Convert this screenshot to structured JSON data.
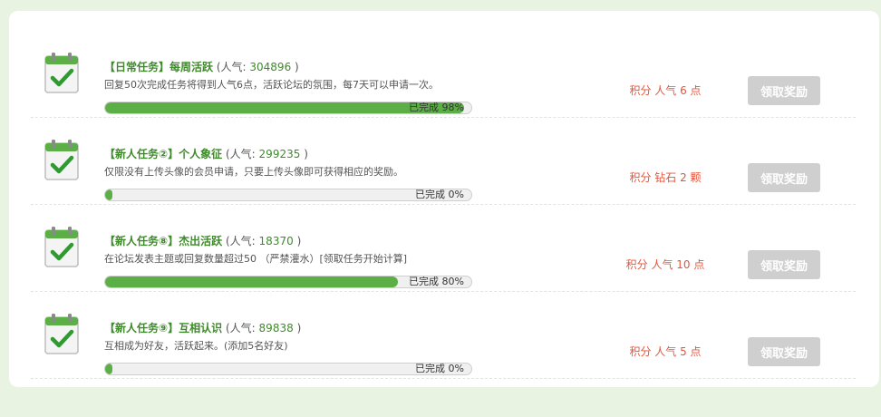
{
  "tasks": [
    {
      "title": "【日常任务】每周活跃",
      "popularity_label": "(人气: ",
      "popularity_value": "304896",
      "popularity_close": ")",
      "description": "回复50次完成任务将得到人气6点，活跃论坛的氛围，每7天可以申请一次。",
      "progress_percent": 98,
      "progress_label": "已完成 98%",
      "reward": "积分 人气 6 点",
      "claim_label": "领取奖励"
    },
    {
      "title": "【新人任务②】个人象征",
      "popularity_label": "(人气: ",
      "popularity_value": "299235",
      "popularity_close": ")",
      "description": "仅限没有上传头像的会员申请，只要上传头像即可获得相应的奖励。",
      "progress_percent": 0,
      "progress_label": "已完成 0%",
      "reward": "积分 钻石 2 颗",
      "claim_label": "领取奖励"
    },
    {
      "title": "【新人任务⑧】杰出活跃",
      "popularity_label": "(人气: ",
      "popularity_value": "18370",
      "popularity_close": ")",
      "description": "在论坛发表主题或回复数量超过50 （严禁灌水）[领取任务开始计算]",
      "progress_percent": 80,
      "progress_label": "已完成 80%",
      "reward": "积分 人气 10 点",
      "claim_label": "领取奖励"
    },
    {
      "title": "【新人任务⑨】互相认识",
      "popularity_label": "(人气: ",
      "popularity_value": "89838",
      "popularity_close": ")",
      "description": "互相成为好友，活跃起来。(添加5名好友)",
      "progress_percent": 0,
      "progress_label": "已完成 0%",
      "reward": "积分 人气 5 点",
      "claim_label": "领取奖励"
    }
  ],
  "icon": "checklist-calendar-icon",
  "colors": {
    "accent_green": "#3f8a2b",
    "progress_green": "#5cae46",
    "reward_red": "#e2553e",
    "button_gray": "#cfcfcf"
  }
}
